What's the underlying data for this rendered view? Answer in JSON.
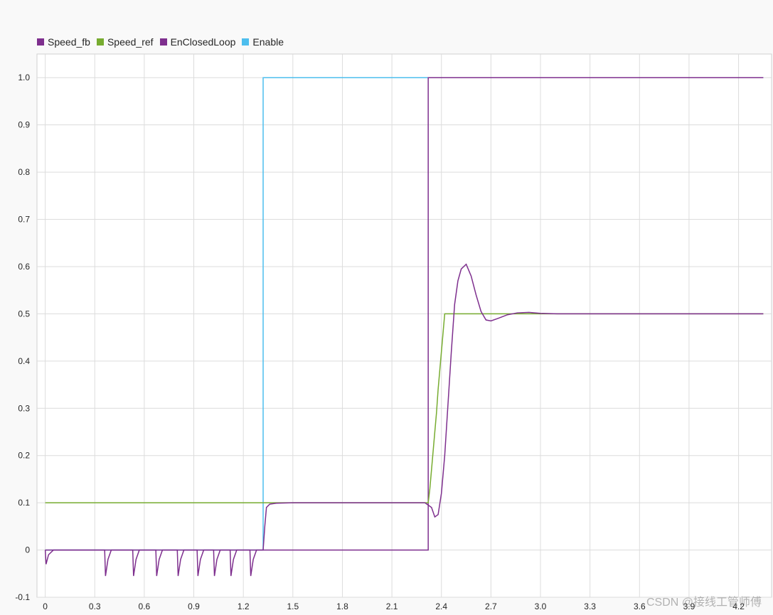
{
  "chart_data": {
    "type": "line",
    "title": "",
    "xlabel": "",
    "ylabel": "",
    "xlim": [
      -0.05,
      4.4
    ],
    "ylim": [
      -0.1,
      1.05
    ],
    "grid": true,
    "legend_position": "top-left",
    "x_ticks": [
      "0",
      "0.3",
      "0.6",
      "0.9",
      "1.2",
      "1.5",
      "1.8",
      "2.1",
      "2.4",
      "2.7",
      "3.0",
      "3.3",
      "3.6",
      "3.9",
      "4.2"
    ],
    "y_ticks": [
      "-0.1",
      "0",
      "0.1",
      "0.2",
      "0.3",
      "0.4",
      "0.5",
      "0.6",
      "0.7",
      "0.8",
      "0.9",
      "1.0"
    ],
    "series": [
      {
        "name": "Speed_fb",
        "color": "#7e2f8e",
        "x": [
          0,
          0.005,
          0.02,
          0.05,
          0.36,
          0.365,
          0.38,
          0.4,
          0.53,
          0.535,
          0.55,
          0.57,
          0.67,
          0.675,
          0.69,
          0.71,
          0.8,
          0.805,
          0.82,
          0.84,
          0.92,
          0.925,
          0.94,
          0.96,
          1.02,
          1.025,
          1.04,
          1.06,
          1.12,
          1.125,
          1.14,
          1.16,
          1.24,
          1.245,
          1.26,
          1.28,
          1.32,
          1.33,
          1.34,
          1.36,
          1.4,
          1.5,
          2.3,
          2.34,
          2.36,
          2.38,
          2.4,
          2.42,
          2.44,
          2.46,
          2.48,
          2.5,
          2.52,
          2.55,
          2.58,
          2.61,
          2.64,
          2.67,
          2.7,
          2.74,
          2.8,
          2.86,
          2.93,
          3.0,
          3.1,
          3.5,
          4.35
        ],
        "values": [
          0,
          -0.03,
          -0.01,
          0,
          0,
          -0.055,
          -0.02,
          0,
          0,
          -0.055,
          -0.02,
          0,
          0,
          -0.055,
          -0.02,
          0,
          0,
          -0.055,
          -0.02,
          0,
          0,
          -0.055,
          -0.02,
          0,
          0,
          -0.055,
          -0.02,
          0,
          0,
          -0.055,
          -0.02,
          0,
          0,
          -0.055,
          -0.02,
          0,
          0,
          0.05,
          0.09,
          0.097,
          0.099,
          0.1,
          0.1,
          0.09,
          0.07,
          0.075,
          0.12,
          0.2,
          0.31,
          0.42,
          0.52,
          0.57,
          0.595,
          0.605,
          0.58,
          0.54,
          0.505,
          0.487,
          0.485,
          0.49,
          0.498,
          0.502,
          0.503,
          0.501,
          0.5,
          0.5,
          0.5
        ]
      },
      {
        "name": "Speed_ref",
        "color": "#77ac30",
        "x": [
          0,
          2.32,
          2.33,
          2.34,
          2.35,
          2.36,
          2.37,
          2.38,
          2.39,
          2.4,
          2.41,
          2.42,
          4.35
        ],
        "values": [
          0.1,
          0.1,
          0.13,
          0.17,
          0.21,
          0.25,
          0.29,
          0.34,
          0.38,
          0.42,
          0.46,
          0.5,
          0.5
        ]
      },
      {
        "name": "EnClosedLoop",
        "color": "#7e2f8e",
        "x": [
          0,
          2.32,
          2.32,
          4.35
        ],
        "values": [
          0,
          0,
          1,
          1
        ]
      },
      {
        "name": "Enable",
        "color": "#4dbeee",
        "x": [
          0,
          1.32,
          1.32,
          4.35
        ],
        "values": [
          0,
          0,
          1,
          1
        ]
      }
    ]
  },
  "watermark": "CSDN @接线工管师傅"
}
